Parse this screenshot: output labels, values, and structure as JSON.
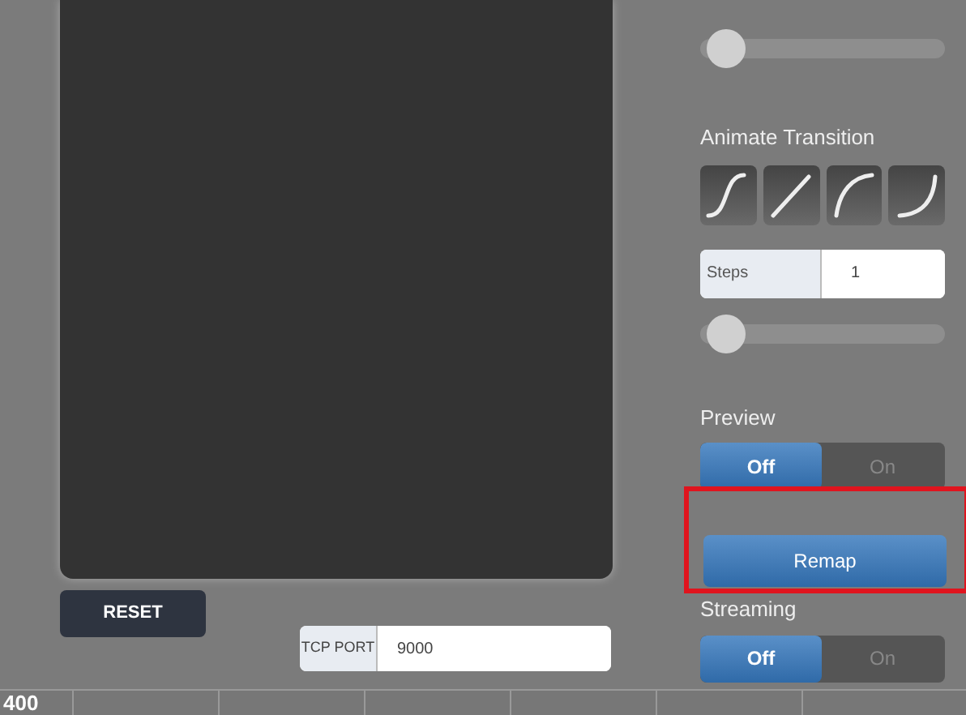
{
  "reset_button": {
    "label": "RESET"
  },
  "tcp_port": {
    "label": "TCP PORT",
    "value": "9000"
  },
  "ruler": {
    "label": "400"
  },
  "top_slider": {
    "level": 0.03
  },
  "animate_transition": {
    "label": "Animate Transition",
    "curves": [
      {
        "kind": "ease",
        "selected": false
      },
      {
        "kind": "linear",
        "selected": false
      },
      {
        "kind": "ease-out",
        "selected": false
      },
      {
        "kind": "ease-in",
        "selected": false
      }
    ]
  },
  "steps": {
    "label": "Steps",
    "value": "1"
  },
  "steps_slider": {
    "level": 0.03
  },
  "preview": {
    "label": "Preview",
    "options": [
      {
        "label": "Off",
        "selected": true
      },
      {
        "label": "On",
        "selected": false
      }
    ]
  },
  "remap_button": {
    "label": "Remap",
    "highlighted": true
  },
  "streaming": {
    "label": "Streaming",
    "options": [
      {
        "label": "Off",
        "selected": true
      },
      {
        "label": "On",
        "selected": false
      }
    ]
  }
}
